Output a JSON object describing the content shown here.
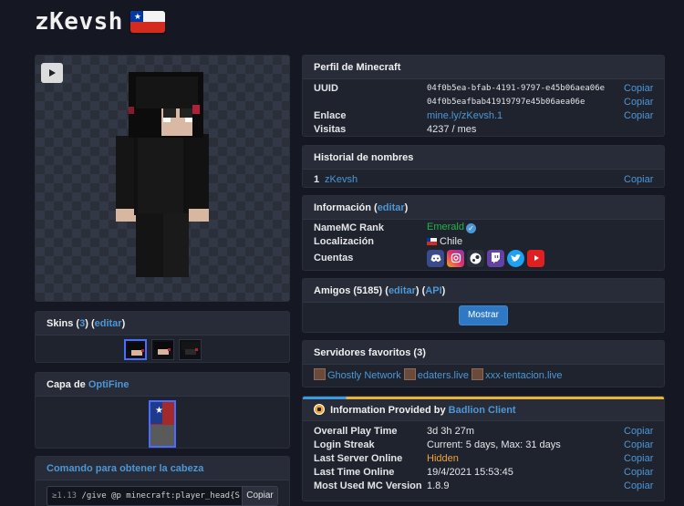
{
  "header": {
    "username": "zKevsh"
  },
  "profile": {
    "title": "Perfil de Minecraft",
    "uuid_label": "UUID",
    "uuid": "04f0b5ea-bfab-4191-9797-e45b06aea06e",
    "uuid_compact": "04f0b5eafbab41919797e45b06aea06e",
    "link_label": "Enlace",
    "link": "mine.ly/zKevsh.1",
    "visits_label": "Visitas",
    "visits": "4237 / mes",
    "copy": "Copiar"
  },
  "name_history": {
    "title": "Historial de nombres",
    "items": [
      {
        "index": "1",
        "name": "zKevsh"
      }
    ],
    "copy": "Copiar"
  },
  "info": {
    "title": "Información",
    "edit": "editar",
    "rank_label": "NameMC Rank",
    "rank": "Emerald",
    "location_label": "Localización",
    "location": "Chile",
    "accounts_label": "Cuentas",
    "accounts": [
      "discord-icon",
      "instagram-icon",
      "steam-icon",
      "twitch-icon",
      "twitter-icon",
      "youtube-icon"
    ]
  },
  "friends": {
    "title_prefix": "Amigos (5185)",
    "edit": "editar",
    "api": "API",
    "show_button": "Mostrar"
  },
  "servers": {
    "title": "Servidores favoritos (3)",
    "items": [
      "Ghostly Network",
      "edaters.live",
      "xxx-tentacion.live"
    ]
  },
  "badlion": {
    "title_prefix": "Information Provided by",
    "title_link": "Badlion Client",
    "rows": [
      {
        "label": "Overall Play Time",
        "value": "3d 3h 27m"
      },
      {
        "label": "Login Streak",
        "value": "Current: 5 days, Max: 31 days"
      },
      {
        "label": "Last Server Online",
        "value": "Hidden"
      },
      {
        "label": "Last Time Online",
        "value": "19/4/2021 15:53:45"
      },
      {
        "label": "Most Used MC Version",
        "value": "1.8.9"
      }
    ],
    "copy": "Copiar"
  },
  "skins": {
    "title": "Skins",
    "count": "3",
    "edit": "editar"
  },
  "cape": {
    "title_prefix": "Capa de",
    "title_link": "OptiFine"
  },
  "head_command": {
    "title": "Comando para obtener la cabeza",
    "version": "≥1.13",
    "command": "/give @p minecraft:player_head{S",
    "copy": "Copiar"
  },
  "colors": {
    "accent": "#4c97d6",
    "rank": "#21b34a",
    "hidden": "#f0a53a",
    "badlion_orange": "#e7b23a"
  }
}
